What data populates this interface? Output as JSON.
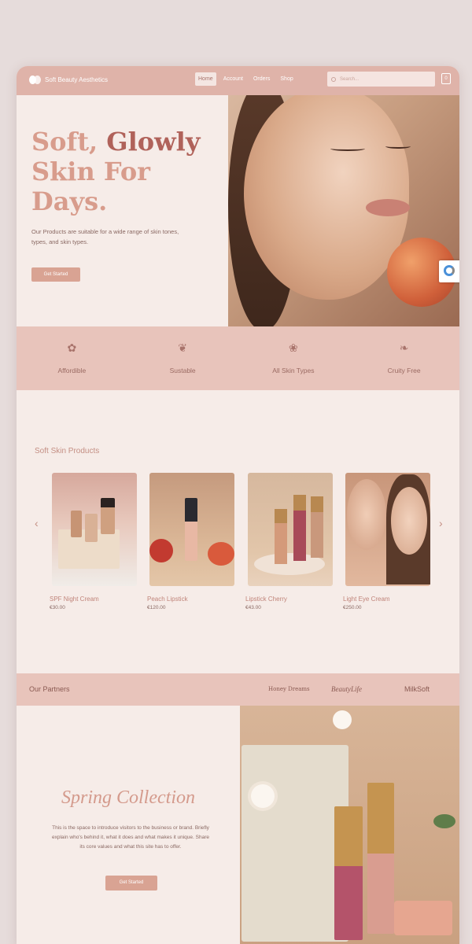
{
  "nav": {
    "brand": "Soft Beauty Aesthetics",
    "menu": [
      "Home",
      "Account",
      "Orders",
      "Shop"
    ],
    "active": "Home",
    "search_placeholder": "Search...",
    "cart_count": "0"
  },
  "hero": {
    "title_1": "Soft, ",
    "title_2": "Glowly",
    "title_3": "Skin For",
    "title_4": "Days.",
    "description": "Our Products are suitable for a wide range of skin tones, types, and skin types.",
    "button": "Get Started"
  },
  "features": [
    {
      "label": "Affordible",
      "icon": "flower-pot-icon"
    },
    {
      "label": "Sustable",
      "icon": "leaf-icon"
    },
    {
      "label": "All Skin Types",
      "icon": "lotus-icon"
    },
    {
      "label": "Cruity Free",
      "icon": "bunny-icon"
    }
  ],
  "products": {
    "title": "Soft Skin Products",
    "items": [
      {
        "name": "SPF Night Cream",
        "price": "€30.00"
      },
      {
        "name": "Peach Lipstick",
        "price": "€120.00"
      },
      {
        "name": "Lipstick Cherry",
        "price": "€43.00"
      },
      {
        "name": "Light Eye Cream",
        "price": "€250.00"
      }
    ]
  },
  "partners": {
    "label": "Our Partners",
    "logos": [
      "Honey Dreams",
      "BeautyLife",
      "MilkSoft"
    ]
  },
  "spring": {
    "title": "Spring Collection",
    "description": "This is the space to introduce visitors to the business or brand. Briefly explain who's behind it, what it does and what makes it unique. Share its core values and what this site has to offer.",
    "button": "Get Started"
  },
  "colors": {
    "accent": "#dfb3a9",
    "background": "#f6ece8",
    "title": "#d89c8c",
    "title_dark": "#b0625a"
  }
}
